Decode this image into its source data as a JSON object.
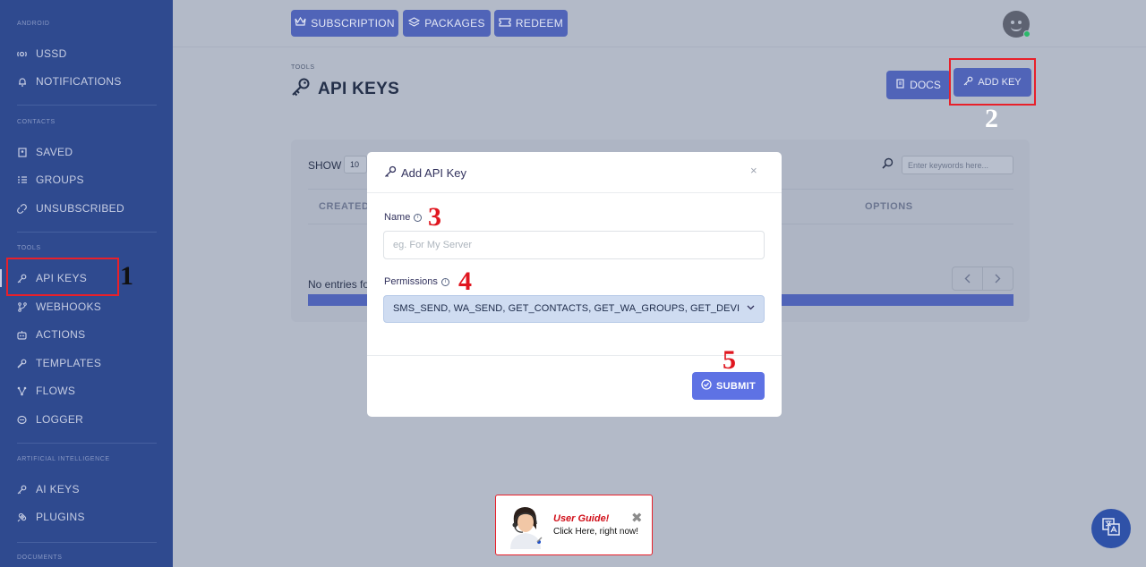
{
  "sidebar": {
    "sections": {
      "android": "ANDROID",
      "contacts": "CONTACTS",
      "tools": "TOOLS",
      "ai": "ARTIFICIAL INTELLIGENCE",
      "documents": "DOCUMENTS"
    },
    "items": {
      "ussd": "USSD",
      "notifications": "NOTIFICATIONS",
      "saved": "SAVED",
      "groups": "GROUPS",
      "unsubscribed": "UNSUBSCRIBED",
      "api_keys": "API KEYS",
      "webhooks": "WEBHOOKS",
      "actions": "ACTIONS",
      "templates": "TEMPLATES",
      "flows": "FLOWS",
      "logger": "LOGGER",
      "ai_keys": "AI KEYS",
      "plugins": "PLUGINS"
    }
  },
  "topbar": {
    "subscription": "SUBSCRIPTION",
    "packages": "PACKAGES",
    "redeem": "REDEEM"
  },
  "header": {
    "breadcrumb": "TOOLS",
    "title": "API KEYS",
    "docs": "DOCS",
    "add_key": "ADD KEY"
  },
  "table": {
    "show_label": "SHOW",
    "show_value": "10",
    "search_placeholder": "Enter keywords here...",
    "col_created": "CREATED",
    "col_options": "OPTIONS",
    "no_entries": "No entries fo"
  },
  "modal": {
    "title": "Add API Key",
    "close": "×",
    "name_label": "Name",
    "name_placeholder": "eg. For My Server",
    "permissions_label": "Permissions",
    "permissions_value": "SMS_SEND, WA_SEND, GET_CONTACTS, GET_WA_GROUPS, GET_DEVI",
    "submit": "SUBMIT"
  },
  "annotations": {
    "n1": "1",
    "n2": "2",
    "n3": "3",
    "n4": "4",
    "n5": "5"
  },
  "guide": {
    "title": "User Guide!",
    "subtitle": "Click Here, right now!",
    "close": "✖"
  },
  "colors": {
    "sidebar": "#2f4a8f",
    "primary": "#5e72e4",
    "annotation_red": "#e0161f"
  }
}
